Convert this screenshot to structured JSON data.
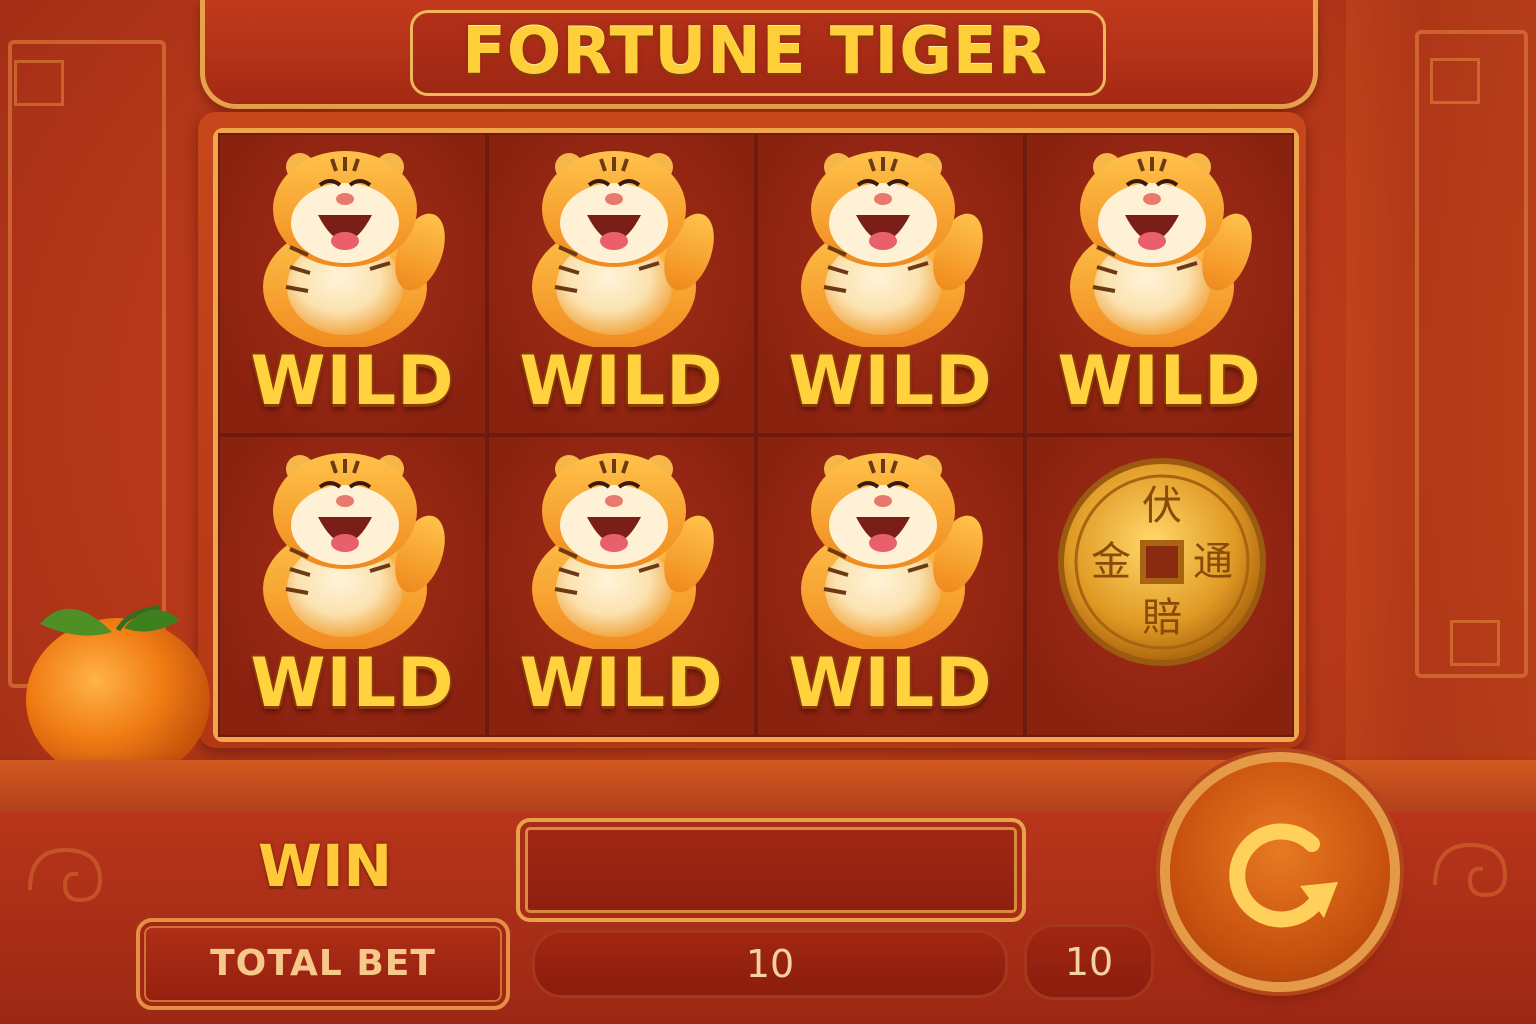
{
  "game": {
    "title": "FORTUNE TIGER"
  },
  "reels": {
    "rows": [
      [
        {
          "symbol": "tiger-wild",
          "label": "WILD"
        },
        {
          "symbol": "tiger-wild",
          "label": "WILD"
        },
        {
          "symbol": "tiger-wild",
          "label": "WILD"
        },
        {
          "symbol": "tiger-wild",
          "label": "WILD"
        }
      ],
      [
        {
          "symbol": "tiger-wild",
          "label": "WILD"
        },
        {
          "symbol": "tiger-wild",
          "label": "WILD"
        },
        {
          "symbol": "tiger-wild",
          "label": "WILD"
        },
        {
          "symbol": "gold-coin",
          "label": ""
        }
      ]
    ],
    "coin_chars": {
      "top": "伏",
      "left": "金",
      "right": "通",
      "bottom": "賠"
    }
  },
  "panel": {
    "win_label": "WIN",
    "win_value": "",
    "total_bet_label": "TOTAL BET",
    "total_bet_value": "10",
    "bet_value_small": "10"
  },
  "controls": {
    "spin_icon": "refresh-icon"
  },
  "decor": {
    "orange_icon": "mandarin-orange-icon"
  },
  "colors": {
    "background": "#b8391a",
    "gold": "#ffcf3a",
    "frame_gold": "#f0a64a",
    "reel_bg": "#8e2412"
  }
}
